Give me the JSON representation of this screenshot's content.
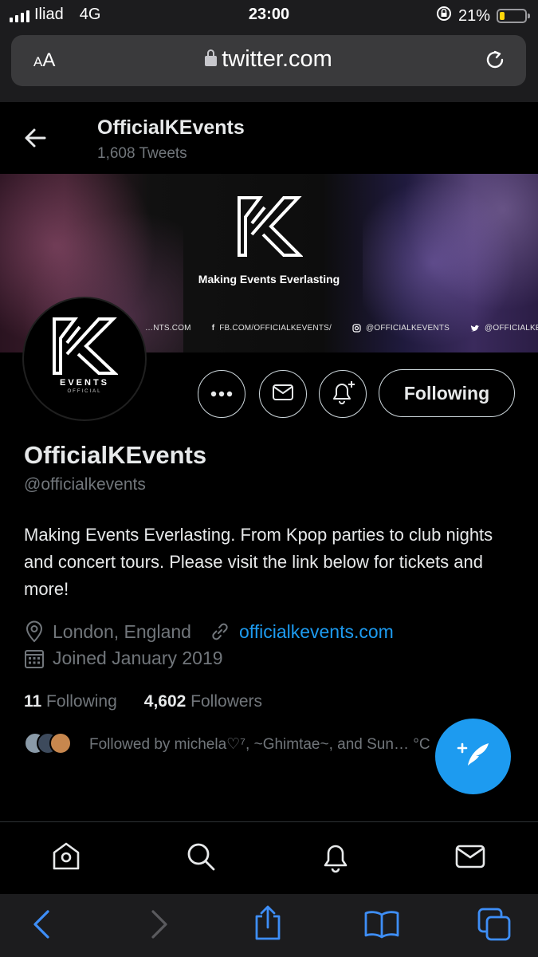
{
  "status_bar": {
    "carrier": "Iliad",
    "network": "4G",
    "time": "23:00",
    "battery": "21%",
    "battery_level_percent": 21
  },
  "browser": {
    "text_size_label": "AA",
    "url": "twitter.com"
  },
  "profile_header": {
    "name": "OfficialKEvents",
    "tweet_count": "1,608 Tweets"
  },
  "banner": {
    "tagline": "Making Events Everlasting",
    "social": [
      "…NTS.COM",
      "FB.COM/OFFICIALKEVENTS/",
      "@OFFICIALKEVENTS",
      "@OFFICIALKEVENTS"
    ]
  },
  "avatar": {
    "text": "EVENTS",
    "subtext": "OFFICIAL"
  },
  "actions": {
    "follow_label": "Following"
  },
  "profile": {
    "name": "OfficialKEvents",
    "handle": "@officialkevents",
    "bio": "Making Events Everlasting. From Kpop parties to club nights and concert tours. Please visit the link below for tickets and more!",
    "location": "London, England",
    "website": "officialkevents.com",
    "joined": "Joined January 2019",
    "following_count": "11",
    "following_label": "Following",
    "followers_count": "4,602",
    "followers_label": "Followers",
    "followed_by": "Followed by michela♡⁷, ~Ghimtae~, and Sun… °C"
  },
  "colors": {
    "accent": "#1d9bf0",
    "text_primary": "#e7e9ea",
    "text_secondary": "#71767b",
    "background": "#000000",
    "browser_chrome": "#1c1c1e"
  },
  "icons": {
    "bottom_nav": [
      "home-icon",
      "search-icon",
      "notifications-icon",
      "messages-icon"
    ],
    "safari_toolbar": [
      "back-icon",
      "forward-icon",
      "share-icon",
      "bookmarks-icon",
      "tabs-icon"
    ]
  }
}
